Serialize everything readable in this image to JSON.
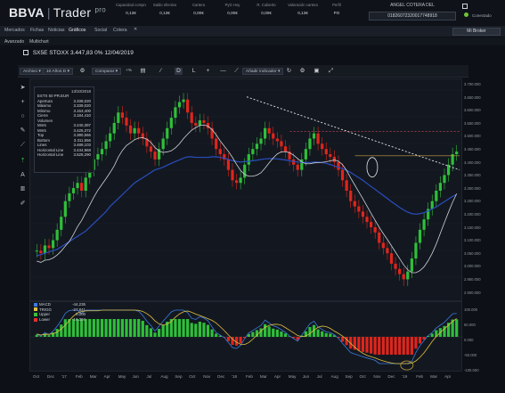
{
  "brand": {
    "name": "BBVA",
    "product": "Trader",
    "pro": "pro"
  },
  "stats": [
    {
      "label": "Capacidad compra",
      "value": "0,13€"
    },
    {
      "label": "Saldo efectivo",
      "value": "0,13€"
    },
    {
      "label": "Cartera",
      "value": "0,00€"
    },
    {
      "label": "PyG Hoy",
      "value": "0,00€"
    },
    {
      "label": "R. Cubierto",
      "value": "0,00€"
    },
    {
      "label": "Valoración cartera",
      "value": "0,13€"
    },
    {
      "label": "Perfil",
      "value": "PO"
    }
  ],
  "account": {
    "label": "ANGEL COTERA DEL",
    "number": "01826072320017748918"
  },
  "connection": {
    "label": "Conectado",
    "color": "#6fc43a"
  },
  "nav": {
    "items": [
      "Mercados",
      "Fichas",
      "Noticias",
      "Gráficos",
      "Social",
      "Cotera"
    ],
    "active": "Gráficos",
    "close_glyph": "✕",
    "broker": "Mi Broker"
  },
  "subtabs": [
    "Avanzado",
    "Multichart"
  ],
  "symbol": {
    "title": "SX5E STOXX",
    "price": "3.447,83",
    "change": "0%",
    "date": "12/04/2019"
  },
  "toolbar": {
    "archivo": "Archivo",
    "period": "10 Años D",
    "compare": "Comparar",
    "percent": "+%",
    "add_indicator": "Añadir indicador"
  },
  "tools": {
    "cursor": "➤",
    "cross": "+",
    "circle": "○",
    "pencil": "✎",
    "line": "⟋",
    "text": "A",
    "trash": "🗑",
    "brush": "✐"
  },
  "info_box": {
    "date": "13/10/2018",
    "title": "ESTX 50 PR.EUR",
    "rows": [
      {
        "label": "Apertura",
        "value": "3.339,020"
      },
      {
        "label": "Máximo",
        "value": "3.339,020"
      },
      {
        "label": "Mínimo",
        "value": "3.153,400"
      },
      {
        "label": "Cierre",
        "value": "3.184,410"
      },
      {
        "label": "Volumen",
        "value": ""
      },
      {
        "label": "Mm5",
        "value": "3.240,397"
      },
      {
        "label": "Mm5",
        "value": "3.425,372"
      },
      {
        "label": "Top",
        "value": "3.380,566"
      },
      {
        "label": "Bottom",
        "value": "3.311,556"
      },
      {
        "label": "Lines",
        "value": "3.489,103"
      },
      {
        "label": "Horizontal Line",
        "value": "3.434,968"
      },
      {
        "label": "Horizontal Line",
        "value": "3.528,290"
      }
    ]
  },
  "y_labels": [
    "3.700.000",
    "3.650.000",
    "3.600.000",
    "3.550.000",
    "3.500.000",
    "3.450.000",
    "3.400.000",
    "3.350.000",
    "3.300.000",
    "3.250.000",
    "3.200.000",
    "3.150.000",
    "3.100.000",
    "3.050.000",
    "3.000.000",
    "2.950.000",
    "2.900.000"
  ],
  "osc_y_labels": [
    "100.000",
    "50.000",
    "0.000",
    "-50.000",
    "-100.000"
  ],
  "x_labels": [
    "Oct",
    "Dec",
    "'17",
    "Feb",
    "Mar",
    "Apr",
    "May",
    "Jun",
    "Jul",
    "Aug",
    "Sep",
    "Oct",
    "Nov",
    "Dec",
    "'18",
    "Feb",
    "Mar",
    "Apr",
    "May",
    "Jun",
    "Jul",
    "Aug",
    "Sep",
    "Oct",
    "Nov",
    "Dec",
    "'19",
    "Feb",
    "Mar",
    "Apr"
  ],
  "osc_legend": [
    {
      "label": "MACD",
      "value": "-44,235",
      "color": "#3d7be0"
    },
    {
      "label": "TRIGG",
      "value": "-27,841",
      "color": "#e0c040"
    },
    {
      "label": "Upper",
      "value": "0,000",
      "color": "#3ac13a"
    },
    {
      "label": "Lower",
      "value": "-16,394",
      "color": "#e03030"
    }
  ],
  "colors": {
    "up": "#2fbf3a",
    "down": "#e0251c",
    "ma_long": "#2a4dbf",
    "ma_short": "#cfd3d9",
    "trend": "#e6e6e6",
    "hline_red": "#e04a5a",
    "hline_gold": "#c8a040"
  },
  "chart_data": {
    "type": "candlestick",
    "title": "SX5E STOXX 3.447,83 0% 12/04/2019",
    "ylim": [
      2900,
      3700
    ],
    "series": [
      {
        "name": "close",
        "values": [
          3070,
          3060,
          3090,
          3080,
          3110,
          3150,
          3200,
          3260,
          3290,
          3310,
          3330,
          3300,
          3350,
          3380,
          3420,
          3440,
          3460,
          3490,
          3520,
          3560,
          3600,
          3580,
          3550,
          3520,
          3540,
          3520,
          3500,
          3470,
          3450,
          3420,
          3460,
          3500,
          3540,
          3580,
          3620,
          3640,
          3650,
          3600,
          3560,
          3550,
          3570,
          3560,
          3540,
          3500,
          3460,
          3440,
          3420,
          3380,
          3340,
          3330,
          3350,
          3400,
          3440,
          3460,
          3480,
          3500,
          3540,
          3520,
          3500,
          3490,
          3470,
          3450,
          3420,
          3400,
          3380,
          3420,
          3460,
          3500,
          3520,
          3480,
          3460,
          3440,
          3430,
          3410,
          3380,
          3340,
          3300,
          3260,
          3240,
          3220,
          3200,
          3180,
          3160,
          3140,
          3100,
          3080,
          3060,
          3020,
          3000,
          2980,
          2960,
          2990,
          3040,
          3100,
          3150,
          3190,
          3230,
          3260,
          3300,
          3330,
          3360,
          3400,
          3440,
          3450
        ]
      }
    ],
    "ma_long": [
      3050,
      3055,
      3060,
      3065,
      3070,
      3075,
      3085,
      3095,
      3105,
      3115,
      3125,
      3135,
      3145,
      3160,
      3175,
      3190,
      3205,
      3220,
      3240,
      3255,
      3270,
      3285,
      3300,
      3315,
      3330,
      3340,
      3350,
      3360,
      3370,
      3380,
      3385,
      3390,
      3398,
      3405,
      3412,
      3418,
      3425,
      3430,
      3430,
      3428,
      3428,
      3428,
      3428,
      3430,
      3430,
      3428,
      3425,
      3420,
      3415,
      3412,
      3410,
      3412,
      3413,
      3415,
      3417,
      3420,
      3422,
      3423,
      3423,
      3422,
      3420,
      3418,
      3415,
      3412,
      3410,
      3408,
      3408,
      3408,
      3410,
      3410,
      3408,
      3405,
      3400,
      3395,
      3390,
      3385,
      3378,
      3370,
      3360,
      3350,
      3340,
      3328,
      3316,
      3305,
      3293,
      3282,
      3270,
      3258,
      3247,
      3236,
      3226,
      3218,
      3212,
      3210,
      3212,
      3216,
      3222,
      3230,
      3238,
      3248,
      3258,
      3268,
      3278,
      3286
    ],
    "hlines": [
      3528,
      3434
    ],
    "trend": {
      "from": [
        3660,
        3380
      ]
    }
  }
}
